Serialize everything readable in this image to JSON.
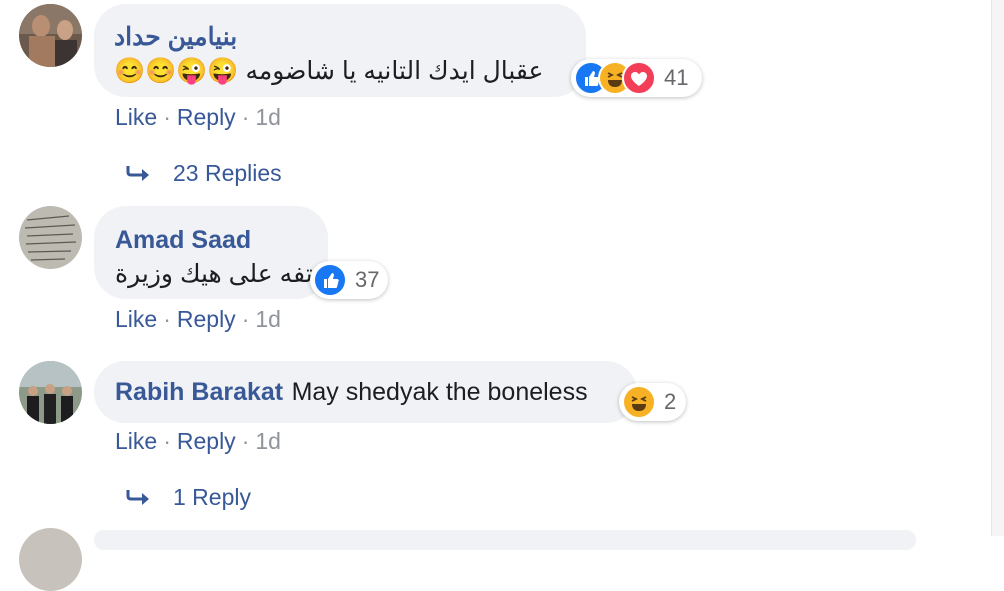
{
  "comments": [
    {
      "author": "بنيامين حداد",
      "text": "عقبال ايدك التانيه يا شاضومه 😜😜😊😊",
      "reaction_count": "41",
      "reactions": [
        "like-icon",
        "haha-icon",
        "love-icon"
      ],
      "actions": {
        "like": "Like",
        "reply": "Reply",
        "time": "1d"
      },
      "replies_label": "23 Replies"
    },
    {
      "author": "Amad Saad",
      "text": "تفه على هيك وزيرة",
      "reaction_count": "37",
      "reactions": [
        "like-icon"
      ],
      "actions": {
        "like": "Like",
        "reply": "Reply",
        "time": "1d"
      }
    },
    {
      "author": "Rabih Barakat",
      "text": "May shedyak the boneless",
      "reaction_count": "2",
      "reactions": [
        "haha-icon"
      ],
      "actions": {
        "like": "Like",
        "reply": "Reply",
        "time": "1d"
      },
      "replies_label": "1 Reply"
    }
  ],
  "colors": {
    "link": "#385898",
    "bubble": "#f0f2f5",
    "like": "#1877f2",
    "love": "#f33e58",
    "haha": "#f7b125"
  }
}
